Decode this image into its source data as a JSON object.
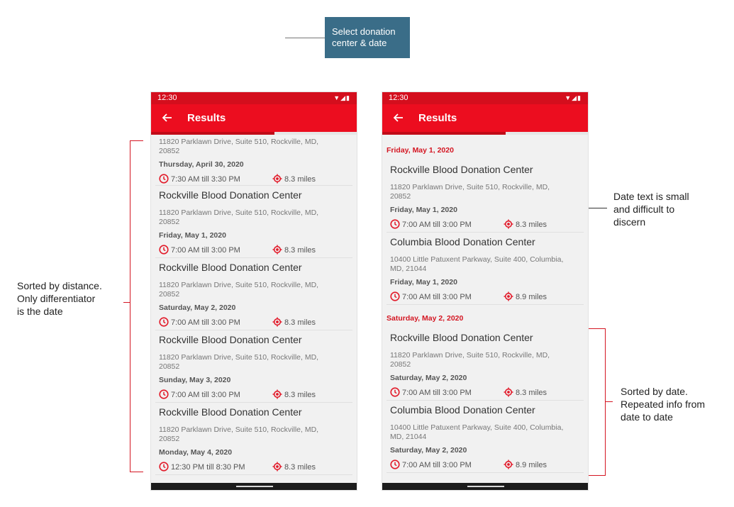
{
  "annotations": {
    "top_box": "Select donation center & date",
    "left": "Sorted by distance.\nOnly differentiator\nis the date",
    "right_top": "Date text is small\nand difficult to\ndiscern",
    "right_bottom": "Sorted by date.\nRepeated info from\ndate to date"
  },
  "colors": {
    "app_bar": "#ec0d1f",
    "status_bar": "#d40e1d",
    "annotation_box": "#3a6d88",
    "section_header": "#d41622"
  },
  "left_screen": {
    "status_time": "12:30",
    "title": "Results",
    "progress": 0.6,
    "partial_item": {
      "address": "11820 Parklawn Drive, Suite 510, Rockville, MD, 20852",
      "date": "Thursday, April 30, 2020",
      "time": "7:30 AM till 3:30 PM",
      "distance": "8.3 miles"
    },
    "items": [
      {
        "name": "Rockville Blood Donation Center",
        "address": "11820 Parklawn Drive, Suite 510, Rockville, MD, 20852",
        "date": "Friday, May 1, 2020",
        "time": "7:00 AM till 3:00 PM",
        "distance": "8.3 miles"
      },
      {
        "name": "Rockville Blood Donation Center",
        "address": "11820 Parklawn Drive, Suite 510, Rockville, MD, 20852",
        "date": "Saturday, May 2, 2020",
        "time": "7:00 AM till 3:00 PM",
        "distance": "8.3 miles"
      },
      {
        "name": "Rockville Blood Donation Center",
        "address": "11820 Parklawn Drive, Suite 510, Rockville, MD, 20852",
        "date": "Sunday, May 3, 2020",
        "time": "7:00 AM till 3:00 PM",
        "distance": "8.3 miles"
      },
      {
        "name": "Rockville Blood Donation Center",
        "address": "11820 Parklawn Drive, Suite 510, Rockville, MD, 20852",
        "date": "Monday, May 4, 2020",
        "time": "12:30 PM till 8:30 PM",
        "distance": "8.3 miles"
      }
    ]
  },
  "right_screen": {
    "status_time": "12:30",
    "title": "Results",
    "progress": 0.6,
    "sections": [
      {
        "header": "Friday, May 1, 2020",
        "items": [
          {
            "name": "Rockville Blood Donation Center",
            "address": "11820 Parklawn Drive, Suite 510, Rockville, MD, 20852",
            "date": "Friday, May 1, 2020",
            "time": "7:00 AM till 3:00 PM",
            "distance": "8.3 miles"
          },
          {
            "name": "Columbia Blood Donation Center",
            "address": "10400 Little Patuxent Parkway, Suite 400, Columbia, MD, 21044",
            "date": "Friday, May 1, 2020",
            "time": "7:00 AM till 3:00 PM",
            "distance": "8.9 miles"
          }
        ]
      },
      {
        "header": "Saturday, May 2, 2020",
        "items": [
          {
            "name": "Rockville Blood Donation Center",
            "address": "11820 Parklawn Drive, Suite 510, Rockville, MD, 20852",
            "date": "Saturday, May 2, 2020",
            "time": "7:00 AM till 3:00 PM",
            "distance": "8.3 miles"
          },
          {
            "name": "Columbia Blood Donation Center",
            "address": "10400 Little Patuxent Parkway, Suite 400, Columbia, MD, 21044",
            "date": "Saturday, May 2, 2020",
            "time": "7:00 AM till 3:00 PM",
            "distance": "8.9 miles"
          }
        ]
      }
    ]
  }
}
